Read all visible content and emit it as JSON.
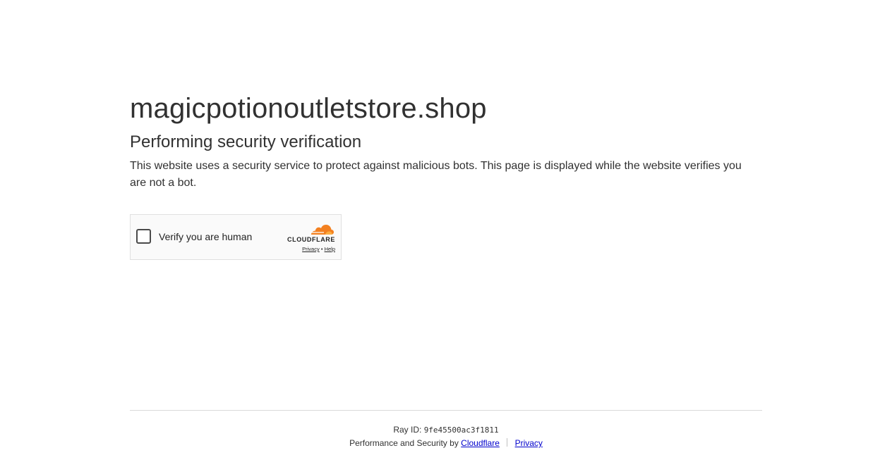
{
  "site": {
    "title": "magicpotionoutletstore.shop"
  },
  "main": {
    "heading": "Performing security verification",
    "description": "This website uses a security service to protect against malicious bots. This page is displayed while the website verifies you are not a bot."
  },
  "widget": {
    "checkbox_label": "Verify you are human",
    "brand": "CLOUDFLARE",
    "privacy_link": "Privacy",
    "link_separator": "•",
    "help_link": "Help",
    "brand_color": "#f38020"
  },
  "footer": {
    "ray_label": "Ray ID:",
    "ray_id": "9fe45500ac3f1811",
    "performance_text": "Performance and Security by",
    "cloudflare_link": "Cloudflare",
    "privacy_link": "Privacy",
    "link_color": "#0000cc"
  }
}
